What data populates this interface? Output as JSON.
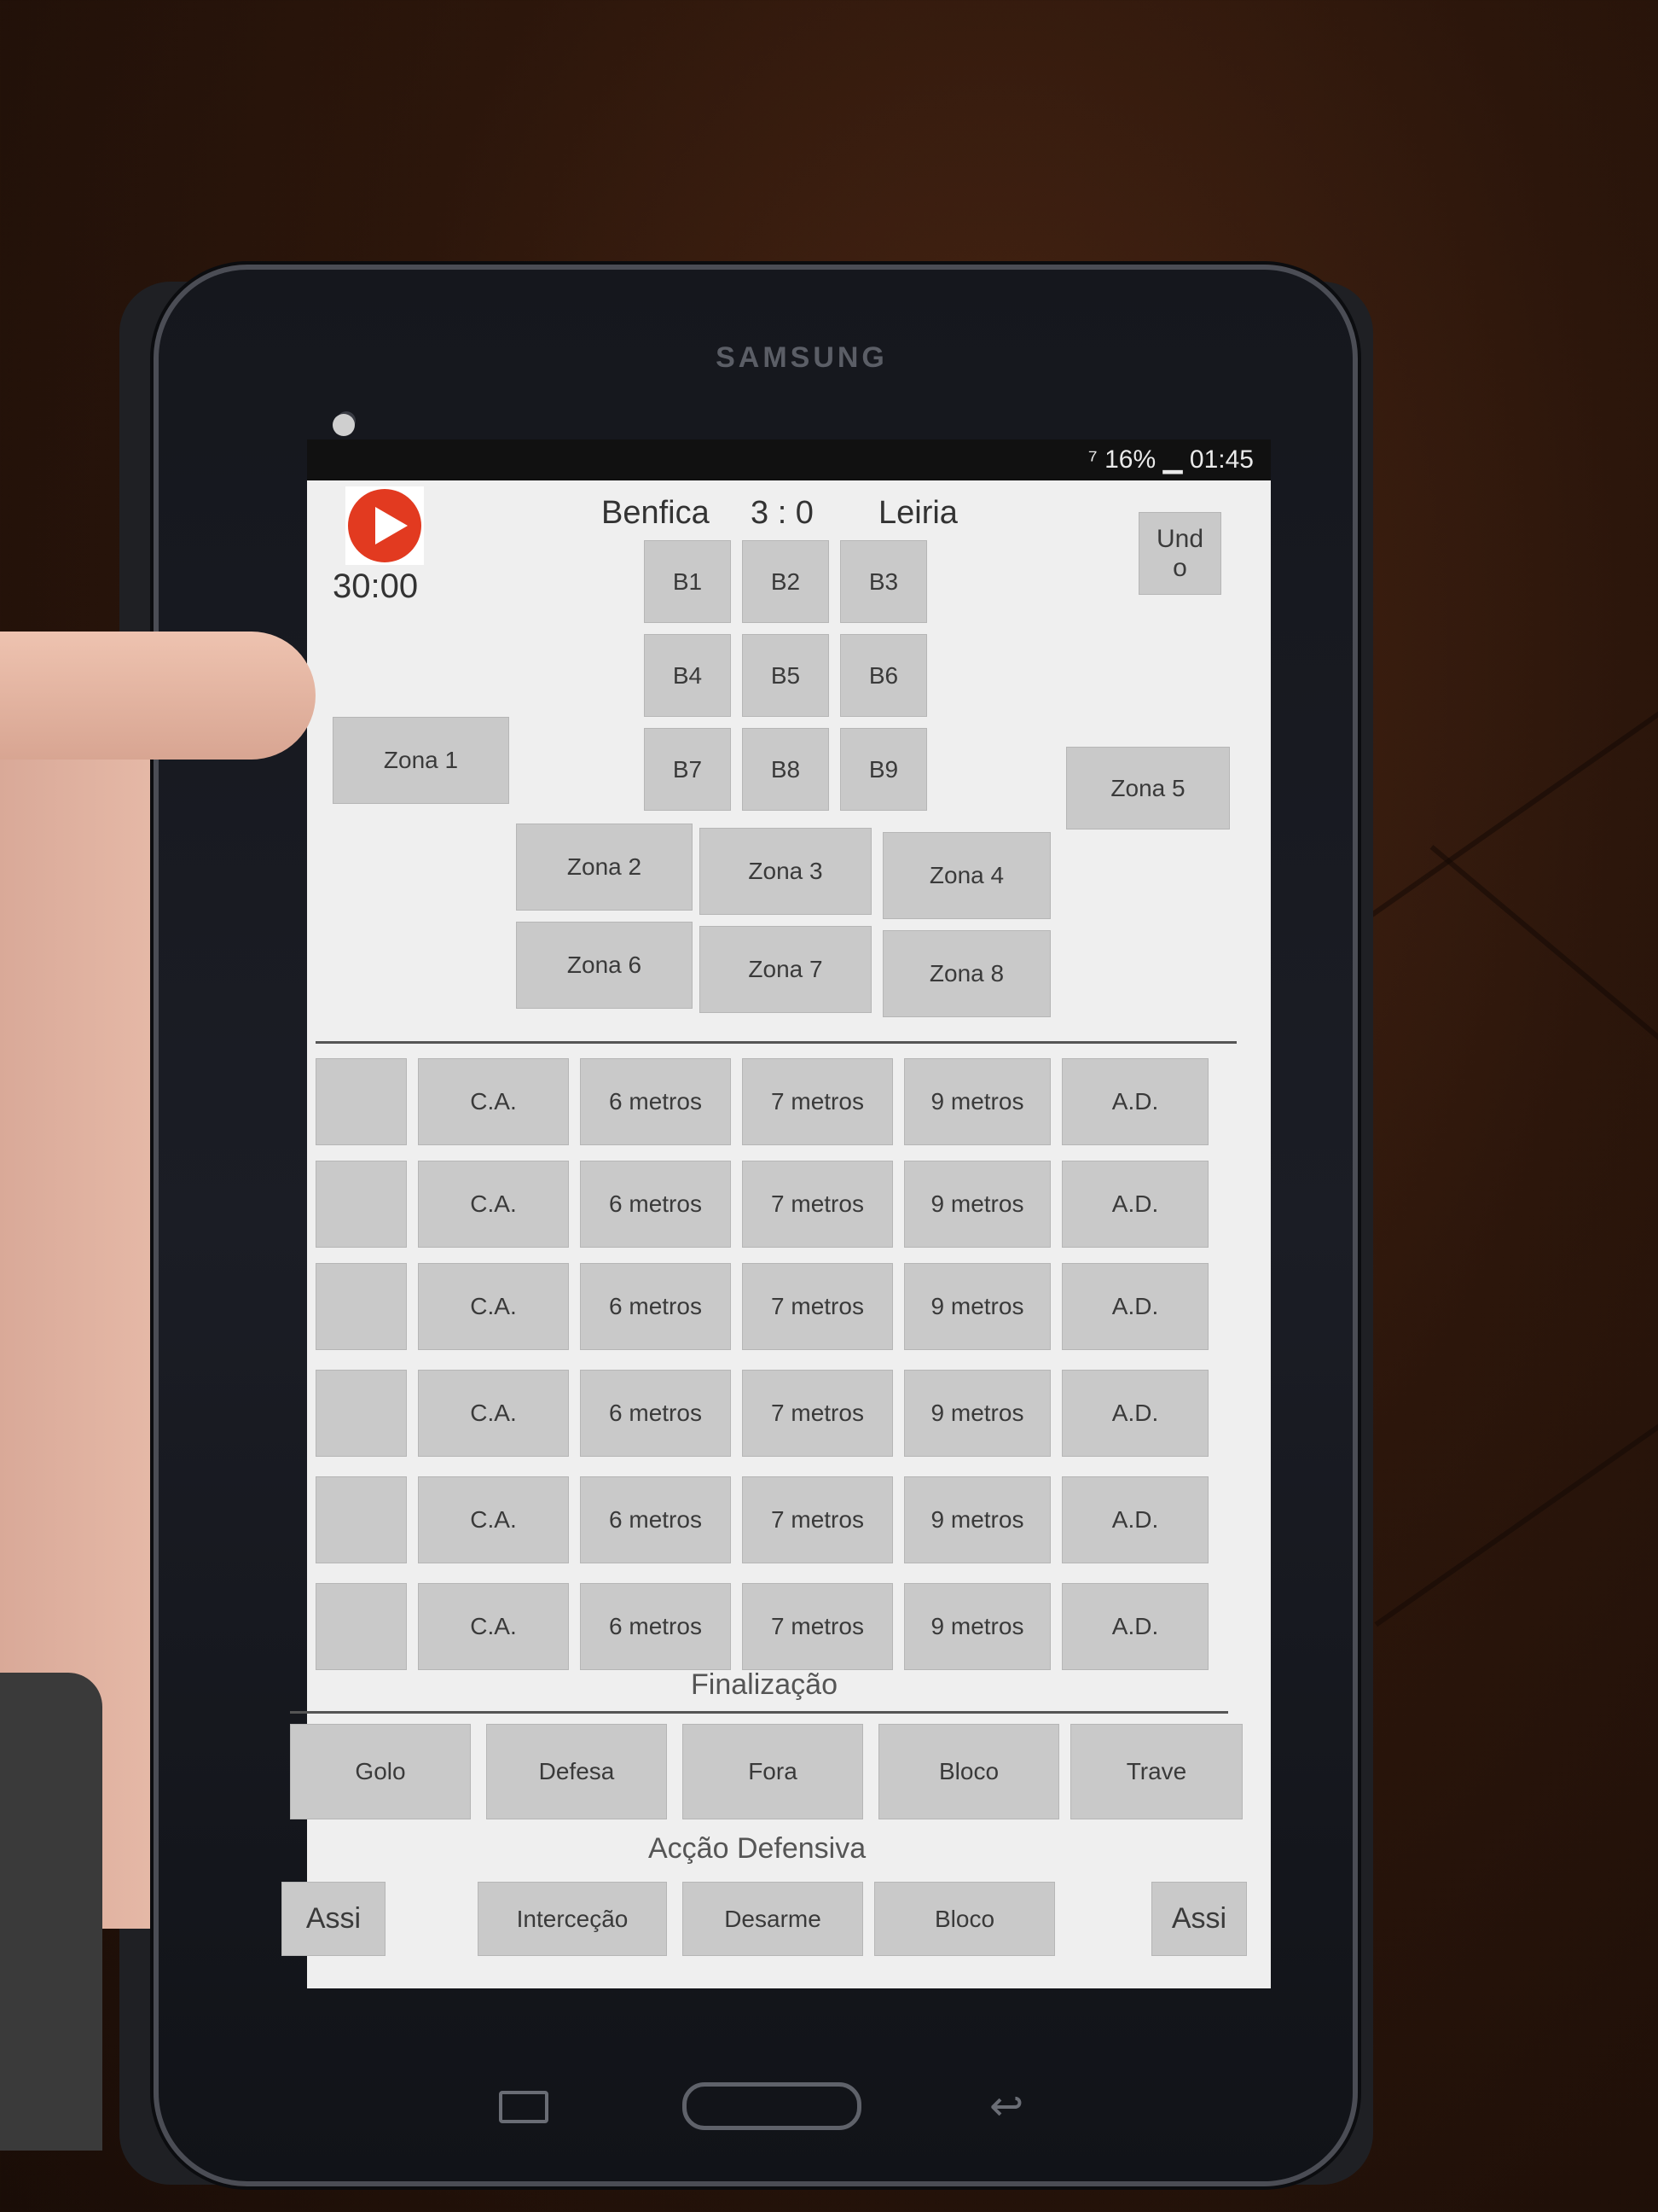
{
  "status_bar": {
    "battery": "16%",
    "time": "01:45"
  },
  "match": {
    "home_team": "Benfica",
    "score": "3 : 0",
    "away_team": "Leiria",
    "clock": "30:00"
  },
  "undo": {
    "line1": "Und",
    "line2": "o"
  },
  "blocks": [
    "B1",
    "B2",
    "B3",
    "B4",
    "B5",
    "B6",
    "B7",
    "B8",
    "B9"
  ],
  "zones": {
    "z1": "Zona 1",
    "z2": "Zona 2",
    "z3": "Zona 3",
    "z4": "Zona 4",
    "z5": "Zona 5",
    "z6": "Zona 6",
    "z7": "Zona 7",
    "z8": "Zona 8"
  },
  "shot_rows": [
    {
      "cols": [
        "C.A.",
        "6 metros",
        "7 metros",
        "9 metros",
        "A.D."
      ]
    },
    {
      "cols": [
        "C.A.",
        "6 metros",
        "7 metros",
        "9 metros",
        "A.D."
      ]
    },
    {
      "cols": [
        "C.A.",
        "6 metros",
        "7 metros",
        "9 metros",
        "A.D."
      ]
    },
    {
      "cols": [
        "C.A.",
        "6 metros",
        "7 metros",
        "9 metros",
        "A.D."
      ]
    },
    {
      "cols": [
        "C.A.",
        "6 metros",
        "7 metros",
        "9 metros",
        "A.D."
      ]
    },
    {
      "cols": [
        "C.A.",
        "6 metros",
        "7 metros",
        "9 metros",
        "A.D."
      ]
    }
  ],
  "finalizacao": {
    "title": "Finalização",
    "buttons": [
      "Golo",
      "Defesa",
      "Fora",
      "Bloco",
      "Trave"
    ]
  },
  "accao_defensiva": {
    "title": "Acção Defensiva",
    "left": "Assi",
    "buttons": [
      "Interceção",
      "Desarme",
      "Bloco"
    ],
    "right": "Assi"
  },
  "device": {
    "brand": "SAMSUNG"
  }
}
